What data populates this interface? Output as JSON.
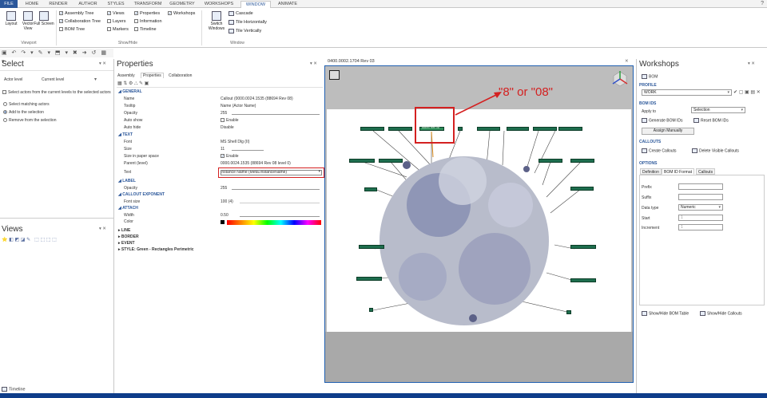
{
  "ribbon": {
    "tabs": [
      "FILE",
      "HOME",
      "RENDER",
      "AUTHOR",
      "STYLES",
      "TRANSFORM",
      "GEOMETRY",
      "WORKSHOPS",
      "WINDOW",
      "ANIMATE"
    ],
    "active_tab": "WINDOW",
    "viewport_group": {
      "buttons": [
        "Layout",
        "Vector View",
        "Full Screen"
      ],
      "label": "Viewport"
    },
    "showhide_group": {
      "checks": [
        {
          "label": "Assembly Tree",
          "checked": true
        },
        {
          "label": "Collaboration Tree",
          "checked": true
        },
        {
          "label": "BOM Tree",
          "checked": false
        },
        {
          "label": "Views",
          "checked": true
        },
        {
          "label": "Layers",
          "checked": false
        },
        {
          "label": "Markers",
          "checked": false
        },
        {
          "label": "Properties",
          "checked": true
        },
        {
          "label": "Information",
          "checked": false
        },
        {
          "label": "Timeline",
          "checked": false
        },
        {
          "label": "Workshops",
          "checked": true
        }
      ],
      "label": "Show/Hide"
    },
    "window_group": {
      "switch": "Switch Windows",
      "items": [
        "Cascade",
        "Tile Horizontally",
        "Tile Vertically"
      ],
      "label": "Window"
    }
  },
  "select_panel": {
    "title": "Select",
    "actor_level_label": "Actor level",
    "actor_level_value": "Current level",
    "option_check": "Select actors from the current levels to the selected actors",
    "radios": [
      "Select matching actors",
      "Add to the selection",
      "Remove from the selection"
    ]
  },
  "views_panel": {
    "title": "Views"
  },
  "properties": {
    "title": "Properties",
    "tabs": [
      "Assembly",
      "Properties",
      "Collaboration"
    ],
    "sections": {
      "general": "GENERAL",
      "text": "TEXT",
      "label": "LABEL",
      "callout_exponent": "CALLOUT EXPONENT",
      "attach": "ATTACH",
      "line": "LINE",
      "border": "BORDER",
      "event": "EVENT",
      "style": "STYLE: Green - Rectangles Perimetric"
    },
    "rows": {
      "name": {
        "key": "Name",
        "value": "Callout (0000.0024.1535 (88694 Rev 08)"
      },
      "tooltip": {
        "key": "Tooltip",
        "value": "Name (Actor Name)"
      },
      "opacity": {
        "key": "Opacity",
        "value": "255"
      },
      "autoshow": {
        "key": "Auto show",
        "value": "Enable"
      },
      "autohide": {
        "key": "Auto hide",
        "value": "Disable"
      },
      "font": {
        "key": "Font",
        "value": "MS Shell Dlg (II)"
      },
      "size": {
        "key": "Size",
        "value": "11"
      },
      "paper": {
        "key": "Size in paper space",
        "value": "Enable"
      },
      "parent": {
        "key": "Parent (level)",
        "value": "0000.0024.1535 (88694 Rev 08 level 0)"
      },
      "text": {
        "key": "Text",
        "value": "Instance Name (Meta.InstanceName)"
      },
      "label_opacity": {
        "key": "Opacity",
        "value": "255"
      },
      "fontsize": {
        "key": "Font size",
        "value": "100 (4)"
      },
      "width": {
        "key": "Width",
        "value": "0.50"
      },
      "color": {
        "key": "Color",
        "value": ""
      }
    }
  },
  "viewport": {
    "title": "0400.0002.1704 Rev 03",
    "highlighted_callout": "88694 Rev 08",
    "annotation": "\"8\" or \"08\""
  },
  "workshops": {
    "title": "Workshops",
    "bom_label": "BOM",
    "profile_title": "PROFILE",
    "profile_value": "WORK",
    "bom_ids_title": "BOM IDS",
    "apply_to_label": "Apply to",
    "apply_to_value": "Selection",
    "generate_btn": "Generate BOM IDs",
    "reset_btn": "Reset BOM IDs",
    "assign_btn": "Assign Manually",
    "callouts_title": "CALLOUTS",
    "create_btn": "Create Callouts",
    "delete_btn": "Delete Visible Callouts",
    "options_title": "OPTIONS",
    "option_tabs": [
      "Definition",
      "BOM ID Format",
      "Callouts"
    ],
    "fields": [
      {
        "label": "Prefix",
        "value": ""
      },
      {
        "label": "Suffix",
        "value": ""
      },
      {
        "label": "Data type",
        "value": "Numeric"
      },
      {
        "label": "Start",
        "value": "1"
      },
      {
        "label": "Increment",
        "value": "1"
      }
    ],
    "show_hide_table": "Show/Hide BOM Table",
    "show_hide_callouts": "Show/Hide Callouts"
  },
  "timeline_label": "Timeline"
}
